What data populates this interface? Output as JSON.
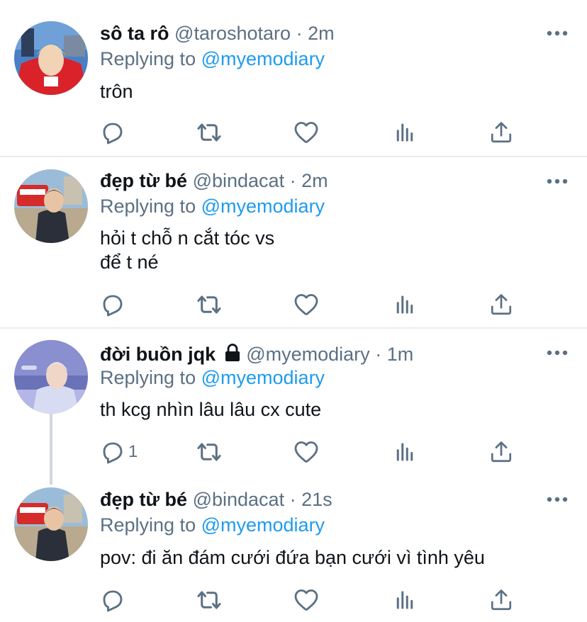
{
  "tweets": [
    {
      "display_name": "sô ta rô",
      "handle": "@taroshotaro",
      "separator": "·",
      "time": "2m",
      "replying_label": "Replying to",
      "replying_to": "@myemodiary",
      "text_lines": [
        "trôn"
      ],
      "reply_count": "",
      "locked": false
    },
    {
      "display_name": "đẹp từ bé",
      "handle": "@bindacat",
      "separator": "·",
      "time": "2m",
      "replying_label": "Replying to",
      "replying_to": "@myemodiary",
      "text_lines": [
        "hỏi t chỗ n cắt tóc vs",
        "để t né"
      ],
      "reply_count": "",
      "locked": false
    },
    {
      "display_name": "đời buồn jqk",
      "handle": "@myemodiary",
      "separator": "·",
      "time": "1m",
      "replying_label": "Replying to",
      "replying_to": "@myemodiary",
      "text_lines": [
        "th kcg nhìn lâu lâu cx cute"
      ],
      "reply_count": "1",
      "locked": true
    },
    {
      "display_name": "đẹp từ bé",
      "handle": "@bindacat",
      "separator": "·",
      "time": "21s",
      "replying_label": "Replying to",
      "replying_to": "@myemodiary",
      "text_lines": [
        "pov: đi ăn đám cưới đứa bạn cưới vì tình yêu"
      ],
      "reply_count": "",
      "locked": false
    }
  ],
  "icons": {
    "reply": "reply-icon",
    "retweet": "retweet-icon",
    "like": "heart-icon",
    "analytics": "analytics-icon",
    "share": "share-icon",
    "more": "more-icon",
    "lock": "lock-icon"
  },
  "colors": {
    "text": "#0f1419",
    "secondary": "#5b7083",
    "mention": "#1d9bf0",
    "divider": "#e6ecf0"
  }
}
